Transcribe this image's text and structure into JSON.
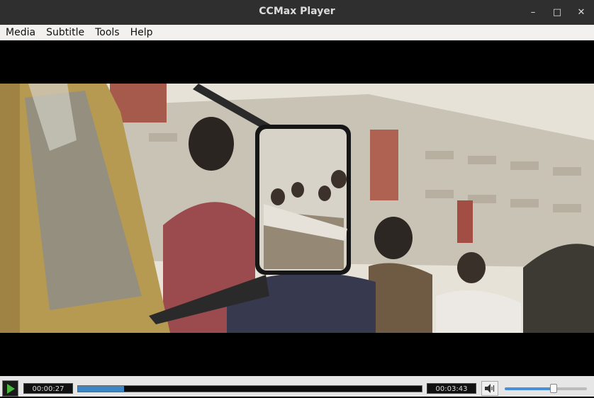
{
  "window": {
    "title": "CCMax Player"
  },
  "menu": [
    "Media",
    "Subtitle",
    "Tools",
    "Help"
  ],
  "playback": {
    "elapsed": "00:00:27",
    "duration": "00:03:43",
    "progress_fraction": 0.133,
    "volume_fraction": 0.6
  },
  "colors": {
    "accent": "#3d86c6",
    "play": "#48b83e"
  },
  "icons": {
    "minimize": "minimize-icon",
    "maximize": "maximize-icon",
    "close": "close-icon",
    "play": "play-icon",
    "volume": "speaker-icon"
  }
}
